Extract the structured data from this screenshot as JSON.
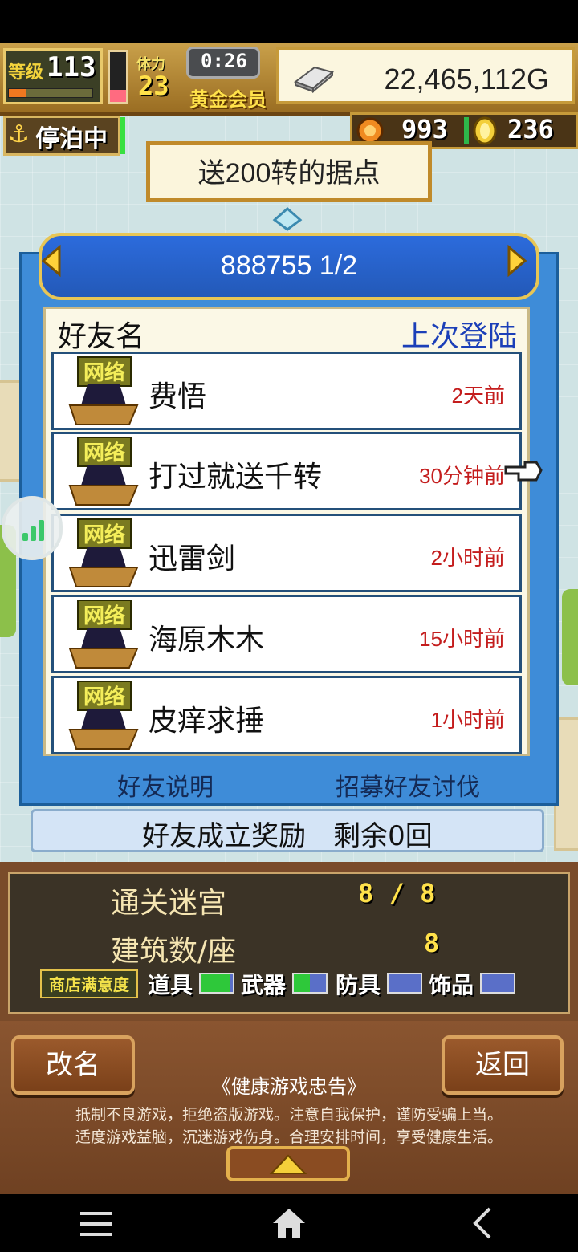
{
  "hud": {
    "level_label": "等级",
    "level_value": "113",
    "level_progress": 0.2,
    "hp_gauge_level": 0.25,
    "stamina_label": "体力",
    "stamina_value": "23",
    "timer": "0:26",
    "vip_label": "黄金会员",
    "gold_value": "22,465,112G",
    "status_label": "停泊中",
    "token_value": "993",
    "medal_value": "236"
  },
  "banner": {
    "title": "送200转的据点"
  },
  "friends": {
    "page_label": "888755 1/2",
    "col_name": "好友名",
    "col_last_login": "上次登陆",
    "ship_tag": "网络",
    "rows": [
      {
        "name": "费悟",
        "time": "2天前"
      },
      {
        "name": "打过就送千转",
        "time": "30分钟前"
      },
      {
        "name": "迅雷剑",
        "time": "2小时前"
      },
      {
        "name": "海原木木",
        "time": "15小时前"
      },
      {
        "name": "皮痒求捶",
        "time": "1小时前"
      }
    ],
    "help_link": "好友说明",
    "recruit_link": "招募好友讨伐",
    "reward_text": "好友成立奖励　剩余0回"
  },
  "stats": {
    "maze_label": "通关迷宫",
    "maze_value": "8 / 8",
    "building_label": "建筑数/座",
    "building_value": "8",
    "satisfaction_label": "商店满意度",
    "shops": [
      {
        "label": "道具",
        "level": 0.9,
        "color": "#2ec83a"
      },
      {
        "label": "武器",
        "level": 0.5,
        "color": "#2ec83a"
      },
      {
        "label": "防具",
        "level": 0.0,
        "color": "#5a6fc8"
      },
      {
        "label": "饰品",
        "level": 0.0,
        "color": "#5a6fc8"
      }
    ]
  },
  "bottom": {
    "rename_button": "改名",
    "back_button": "返回",
    "health_title": "《健康游戏忠告》",
    "health_line1": "抵制不良游戏，拒绝盗版游戏。注意自我保护，谨防受骗上当。",
    "health_line2": "适度游戏益脑，沉迷游戏伤身。合理安排时间，享受健康生活。"
  },
  "colors": {
    "panel_blue": "#3e8cd8",
    "time_red": "#c41d1d",
    "gold_yellow": "#ffe14a"
  },
  "icons": {
    "anchor": "anchor-icon",
    "gold": "silver-bar-icon",
    "token": "orange-token-icon",
    "medal": "gold-medal-icon",
    "pointer": "pointing-hand-icon"
  }
}
